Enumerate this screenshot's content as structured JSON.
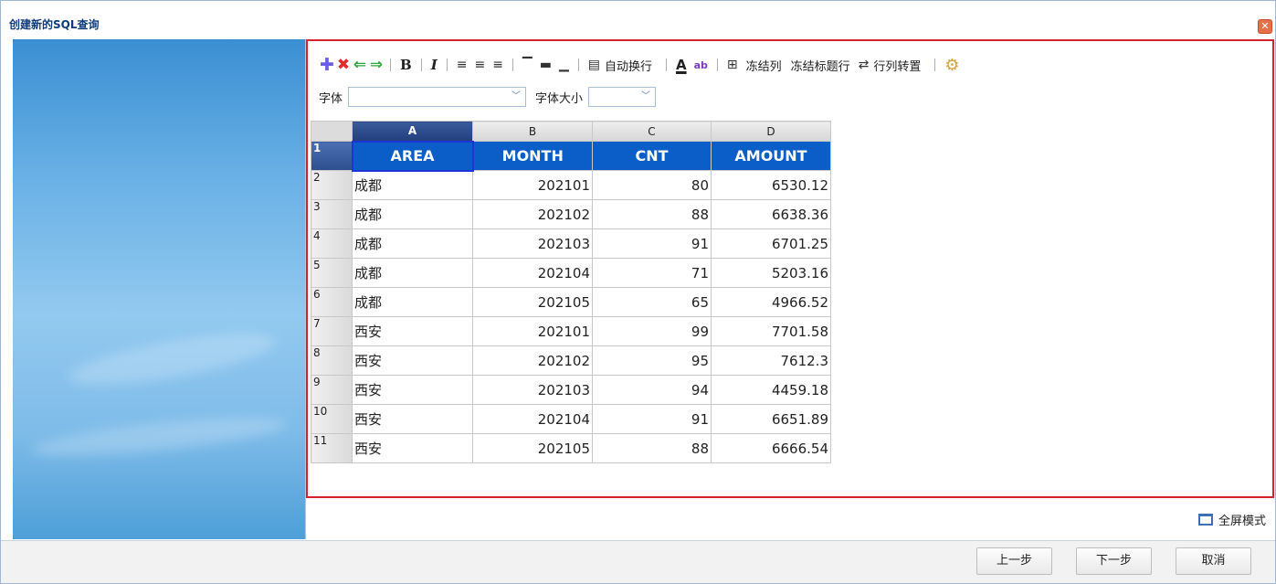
{
  "window": {
    "title": "创建新的SQL查询",
    "close_glyph": "✕"
  },
  "toolbar": {
    "add_icon": "✚",
    "delete_icon": "✖",
    "left_icon": "⇐",
    "right_icon": "⇒",
    "bold_label": "B",
    "italic_label": "I",
    "align_left_icon": "≡",
    "align_center_icon": "≡",
    "align_right_icon": "≡",
    "valign_top_icon": "▔",
    "valign_mid_icon": "▬",
    "valign_bottom_icon": "▁",
    "wrap_icon": "▤",
    "wrap_label": "自动换行",
    "text_color_label": "A",
    "bg_color_icon": "ab",
    "border_icon": "⊞",
    "freeze_col_label": "冻结列",
    "freeze_title_label": "冻结标题行",
    "transpose_icon": "⇄",
    "transpose_label": "行列转置",
    "settings_icon": "⚙",
    "font_label": "字体",
    "font_value": "",
    "font_size_label": "字体大小",
    "font_size_value": "",
    "dropdown_arrow": "﹀"
  },
  "sheet": {
    "columns": [
      "A",
      "B",
      "C",
      "D"
    ],
    "selected_column": "A",
    "header_row_num": "1",
    "headers": [
      "AREA",
      "MONTH",
      "CNT",
      "AMOUNT"
    ],
    "rows": [
      {
        "num": "2",
        "area": "成都",
        "month": "202101",
        "cnt": "80",
        "amount": "6530.12"
      },
      {
        "num": "3",
        "area": "成都",
        "month": "202102",
        "cnt": "88",
        "amount": "6638.36"
      },
      {
        "num": "4",
        "area": "成都",
        "month": "202103",
        "cnt": "91",
        "amount": "6701.25"
      },
      {
        "num": "5",
        "area": "成都",
        "month": "202104",
        "cnt": "71",
        "amount": "5203.16"
      },
      {
        "num": "6",
        "area": "成都",
        "month": "202105",
        "cnt": "65",
        "amount": "4966.52"
      },
      {
        "num": "7",
        "area": "西安",
        "month": "202101",
        "cnt": "99",
        "amount": "7701.58"
      },
      {
        "num": "8",
        "area": "西安",
        "month": "202102",
        "cnt": "95",
        "amount": "7612.3"
      },
      {
        "num": "9",
        "area": "西安",
        "month": "202103",
        "cnt": "94",
        "amount": "4459.18"
      },
      {
        "num": "10",
        "area": "西安",
        "month": "202104",
        "cnt": "91",
        "amount": "6651.89"
      },
      {
        "num": "11",
        "area": "西安",
        "month": "202105",
        "cnt": "88",
        "amount": "6666.54"
      }
    ]
  },
  "fullscreen_label": "全屏模式",
  "footer": {
    "prev_label": "上一步",
    "next_label": "下一步",
    "cancel_label": "取消"
  },
  "colors": {
    "accent_blue": "#0b5ec7",
    "highlight_red": "#d4252f",
    "title_blue": "#0d3b7a"
  }
}
